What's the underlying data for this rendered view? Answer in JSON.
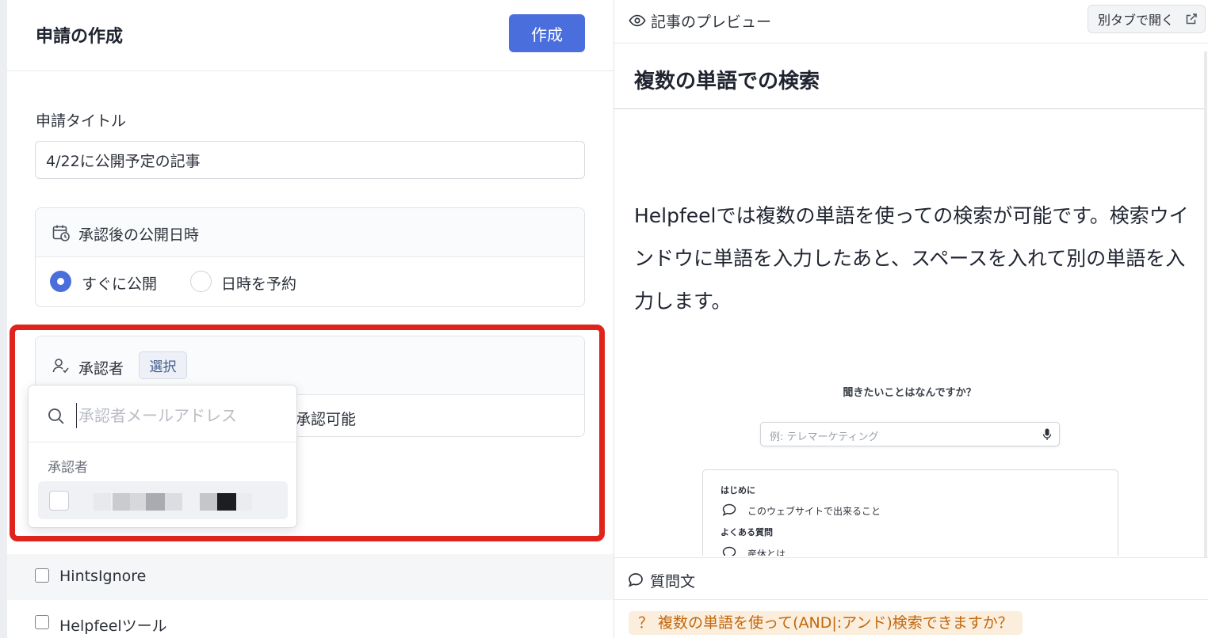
{
  "form": {
    "title": "申請の作成",
    "create_label": "作成",
    "application_title_label": "申請タイトル",
    "application_title_value": "4/22に公開予定の記事",
    "publish": {
      "heading": "承認後の公開日時",
      "option_now": "すぐに公開",
      "option_schedule": "日時を予約",
      "selected": "すぐに公開"
    },
    "approver": {
      "heading": "承認者",
      "select_label": "選択",
      "approvable_suffix": "承認可能"
    },
    "dropdown": {
      "search_placeholder": "承認者メールアドレス",
      "group_label": "承認者"
    },
    "tree": [
      {
        "label": "HintsIgnore"
      },
      {
        "label": "Helpfeelツール"
      }
    ]
  },
  "preview": {
    "heading": "記事のプレビュー",
    "open_tab_label": "別タブで開く",
    "article_title": "複数の単語での検索",
    "article_body": "Helpfeelでは複数の単語を使っての検索が可能です。検索ウインドウに単語を入力したあと、スペースを入れて別の単語を入力します。",
    "screenshot": {
      "question": "聞きたいことはなんですか？",
      "search_placeholder": "例: テレマーケティング",
      "section1": "はじめに",
      "item1": "このウェブサイトで出来ること",
      "section2": "よくある質問",
      "item2": "産休とは"
    },
    "question_heading": "質問文",
    "question_tag": "？ 複数の単語を使って(AND|:アンド)検索できますか？"
  },
  "colors": {
    "primary": "#4a6fdc",
    "highlight_frame": "#e0241b",
    "question_tag_bg": "#fbeedd",
    "question_tag_text": "#c2670d"
  }
}
